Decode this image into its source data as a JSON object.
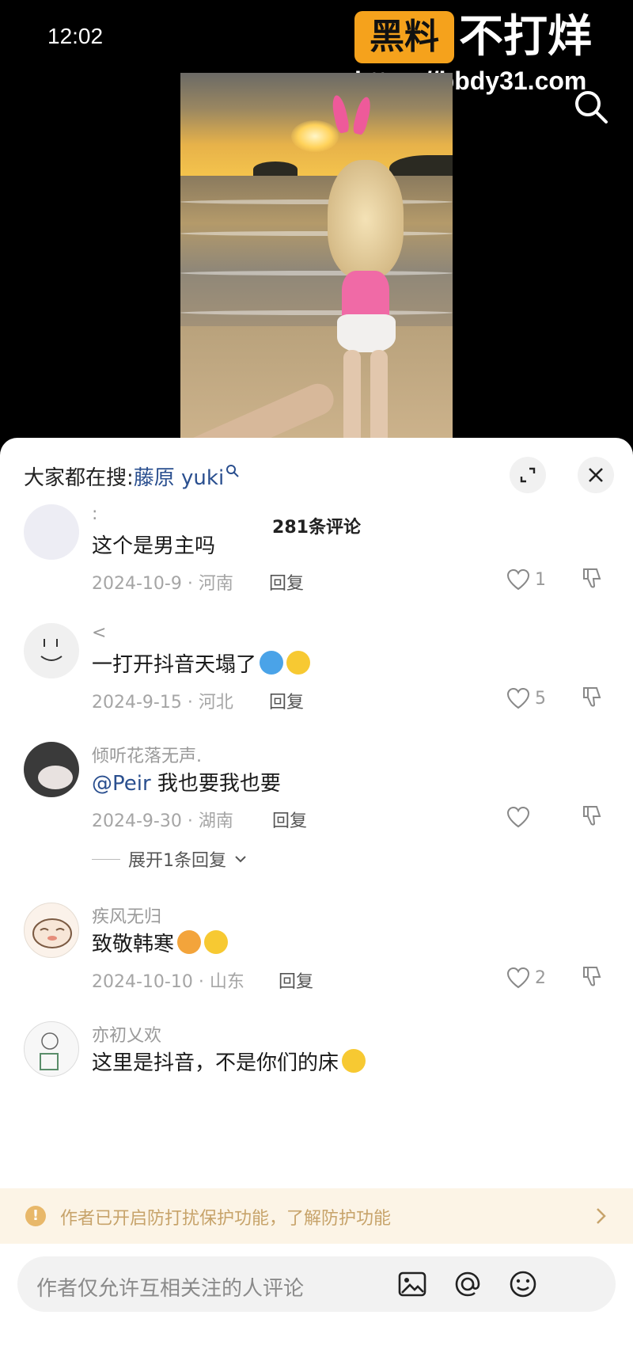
{
  "status_bar": {
    "time": "12:02"
  },
  "watermark": {
    "badge": "黑料",
    "text": "不打烊",
    "url": "https://bbdy31.com"
  },
  "sheet": {
    "hot_search_prefix": "大家都在搜:",
    "hot_search_keyword": "藤原 yuki",
    "comment_count": "281条评论"
  },
  "comments": [
    {
      "username": ":",
      "text": "这个是男主吗",
      "date_location": "2024-10-9 · 河南",
      "reply_label": "回复",
      "likes": "1"
    },
    {
      "username": "<",
      "text": "一打开抖音天塌了",
      "date_location": "2024-9-15 · 河北",
      "reply_label": "回复",
      "likes": "5"
    },
    {
      "username": "倾听花落无声.",
      "mention": "@Peir",
      "text": " 我也要我也要",
      "date_location": "2024-9-30 · 湖南",
      "reply_label": "回复",
      "likes": "",
      "expand_replies": "展开1条回复"
    },
    {
      "username": "疾风无归",
      "text": "致敬韩寒",
      "date_location": "2024-10-10 · 山东",
      "reply_label": "回复",
      "likes": "2"
    },
    {
      "username": "亦初乂欢",
      "text": "这里是抖音，不是你们的床"
    }
  ],
  "notice": {
    "text": "作者已开启防打扰保护功能，了解防护功能"
  },
  "input": {
    "placeholder": "作者仅允许互相关注的人评论"
  },
  "colors": {
    "accent_link": "#2a4f8f",
    "notice_bg": "#fcf4e6",
    "watermark_badge": "#f5a21c"
  }
}
